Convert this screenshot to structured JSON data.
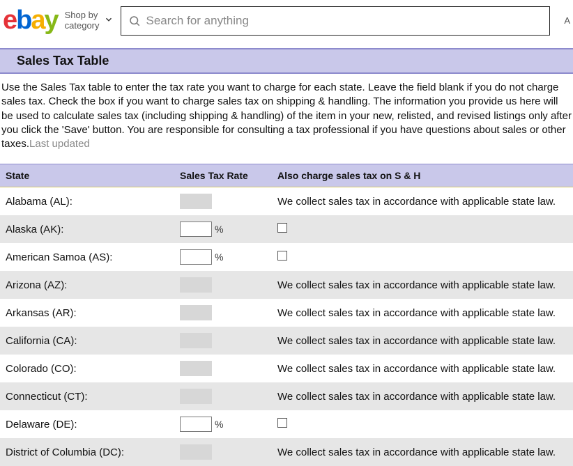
{
  "header": {
    "shop_by_1": "Shop by",
    "shop_by_2": "category",
    "search_placeholder": "Search for anything",
    "advanced_stub": "A"
  },
  "section": {
    "title": "Sales Tax Table"
  },
  "intro": {
    "text": "Use the Sales Tax table to enter the tax rate you want to charge for each state. Leave the field blank if you do not charge sales tax. Check the box if you want to charge sales tax on shipping & handling. The information you provide us here will be used to calculate sales tax (including shipping & handling) of the item in your new, relisted, and revised listings only after you click the 'Save' button. You are responsible for consulting a tax professional if you have questions about sales or other taxes.",
    "last_updated": "Last updated"
  },
  "columns": {
    "state": "State",
    "rate": "Sales Tax Rate",
    "sandh": "Also charge sales tax on S & H"
  },
  "collect_text": "We collect sales tax in accordance with applicable state law.",
  "percent": "%",
  "rows": [
    {
      "state": "Alabama (AL):",
      "editable": false,
      "alt": false
    },
    {
      "state": "Alaska (AK):",
      "editable": true,
      "alt": true
    },
    {
      "state": "American Samoa (AS):",
      "editable": true,
      "alt": false
    },
    {
      "state": "Arizona (AZ):",
      "editable": false,
      "alt": true
    },
    {
      "state": "Arkansas (AR):",
      "editable": false,
      "alt": false
    },
    {
      "state": "California (CA):",
      "editable": false,
      "alt": true
    },
    {
      "state": "Colorado (CO):",
      "editable": false,
      "alt": false
    },
    {
      "state": "Connecticut (CT):",
      "editable": false,
      "alt": true
    },
    {
      "state": "Delaware (DE):",
      "editable": true,
      "alt": false
    },
    {
      "state": "District of Columbia (DC):",
      "editable": false,
      "alt": true
    }
  ]
}
